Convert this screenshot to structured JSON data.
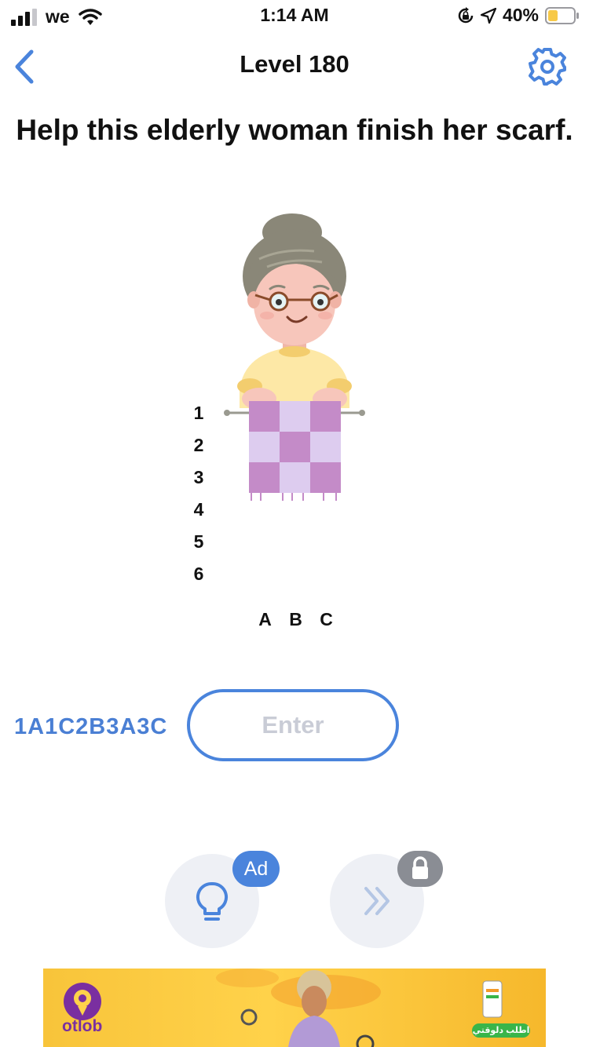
{
  "status_bar": {
    "carrier": "we",
    "time": "1:14 AM",
    "battery_percent": "40%",
    "battery_level": 0.4
  },
  "nav": {
    "level_title": "Level 180"
  },
  "question": {
    "text": "Help this elderly woman finish her scarf."
  },
  "puzzle": {
    "row_labels": [
      "1",
      "2",
      "3",
      "4",
      "5",
      "6"
    ],
    "column_labels": [
      "A",
      "B",
      "C"
    ]
  },
  "answer": {
    "hint_text": "1A1C2B3A3C",
    "placeholder": "Enter",
    "value": ""
  },
  "buttons": {
    "hint_badge": "Ad"
  },
  "ad_banner": {
    "brand": "otlob",
    "cta": "اطلب دلوقتي"
  },
  "colors": {
    "accent": "#4a84dc",
    "scarf_dark": "#c48bc8",
    "scarf_light": "#ddccef",
    "circle_button_bg": "#eef0f5",
    "lock_badge": "#8a8d94",
    "ad_background": "#f8c43a"
  },
  "icons": [
    "signal-icon",
    "wifi-icon",
    "rotation-lock-icon",
    "location-arrow-icon",
    "battery-icon",
    "back-chevron-icon",
    "gear-icon",
    "lightbulb-icon",
    "double-chevron-icon",
    "lock-icon"
  ]
}
